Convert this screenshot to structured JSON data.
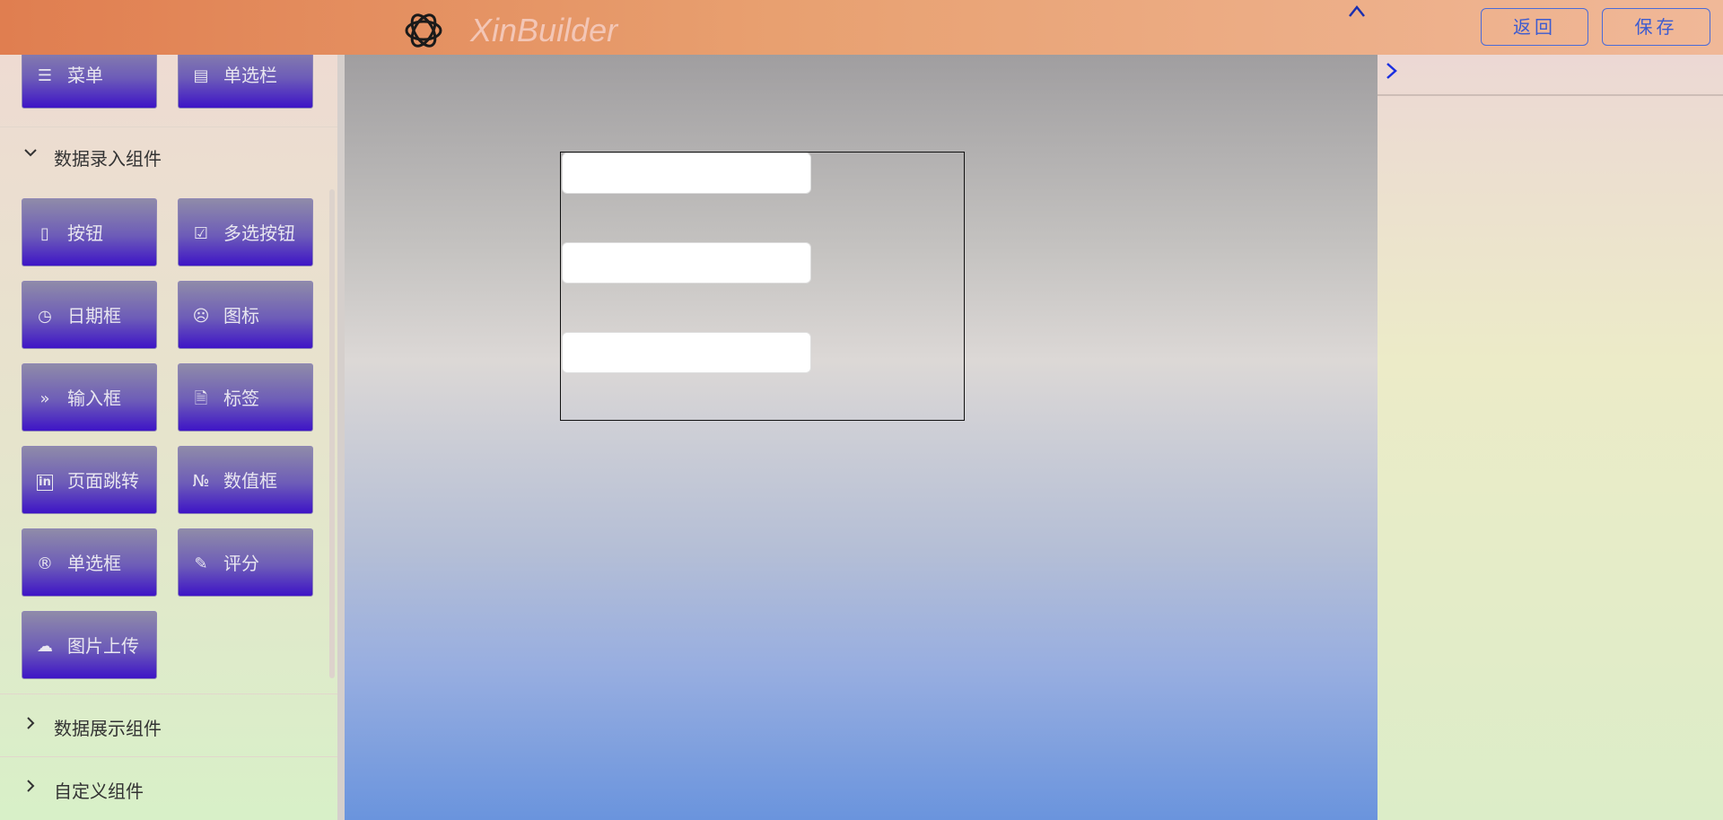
{
  "header": {
    "title": "XinBuilder",
    "back_label": "返回",
    "save_label": "保存",
    "logo_icon": "openai-knot-icon",
    "collapse_icon": "chevron-up-icon",
    "gradient": [
      "#e07e50",
      "#f0b898"
    ]
  },
  "sidebar": {
    "top_items": [
      {
        "label": "菜单",
        "icon": "menu-list-icon"
      },
      {
        "label": "单选栏",
        "icon": "frame-icon"
      }
    ],
    "sections": [
      {
        "title": "数据录入组件",
        "expanded": true,
        "items": [
          {
            "label": "按钮",
            "icon": "tablet-icon"
          },
          {
            "label": "多选按钮",
            "icon": "checkbox-icon"
          },
          {
            "label": "日期框",
            "icon": "clock-icon"
          },
          {
            "label": "图标",
            "icon": "frown-icon"
          },
          {
            "label": "输入框",
            "icon": "double-chevron-right-icon"
          },
          {
            "label": "标签",
            "icon": "document-icon"
          },
          {
            "label": "页面跳转",
            "icon": "linkedin-icon"
          },
          {
            "label": "数值框",
            "icon": "number-sign-icon"
          },
          {
            "label": "单选框",
            "icon": "registered-icon"
          },
          {
            "label": "评分",
            "icon": "edit-icon"
          },
          {
            "label": "图片上传",
            "icon": "cloud-upload-icon"
          }
        ]
      },
      {
        "title": "数据展示组件",
        "expanded": false
      },
      {
        "title": "自定义组件",
        "expanded": false
      }
    ],
    "button_gradient": [
      "#8f8ba9",
      "#3e14c6"
    ]
  },
  "canvas": {
    "form_fields": [
      {
        "value": ""
      },
      {
        "value": ""
      },
      {
        "value": ""
      }
    ],
    "gradient": [
      "#a09ea0",
      "#dcd8d6",
      "#6a94dd"
    ]
  },
  "right_panel": {
    "expand_icon": "chevron-right-icon"
  }
}
